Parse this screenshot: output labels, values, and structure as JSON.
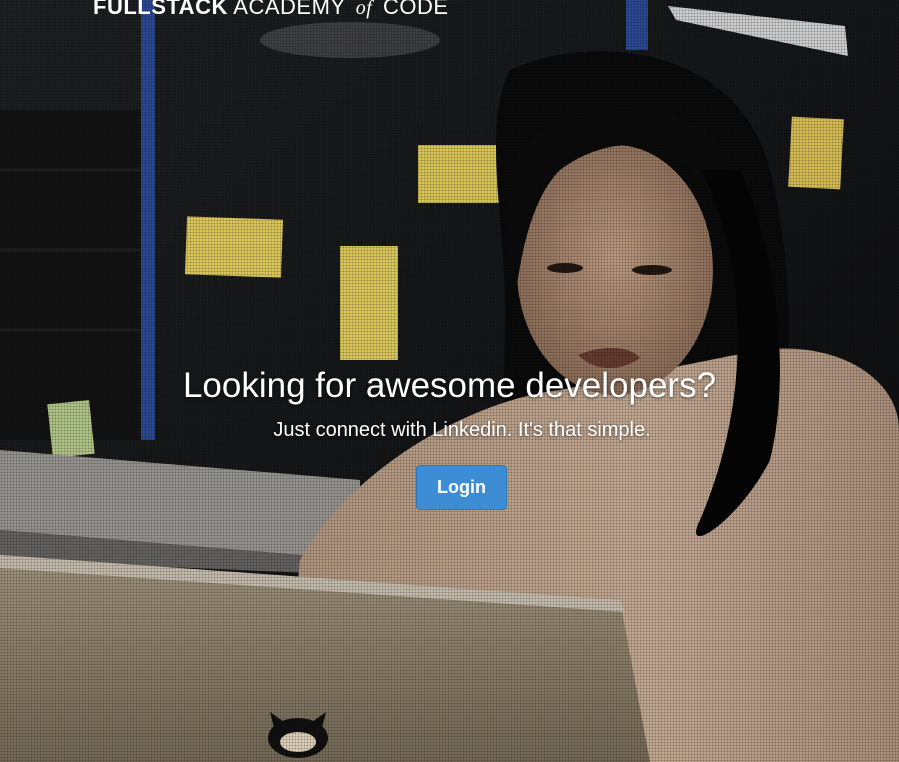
{
  "brand": {
    "name_strong": "FULLSTACK",
    "name_light": "ACADEMY",
    "name_of": "of",
    "name_end": "CODE"
  },
  "hero": {
    "headline": "Looking for awesome developers?",
    "subline": "Just connect with Linkedin. It's that simple.",
    "login_label": "Login"
  },
  "colors": {
    "button_bg": "#3c8dd3",
    "button_border": "#2f78b8",
    "text": "#ffffff",
    "sticky_note": "#e6d361"
  }
}
